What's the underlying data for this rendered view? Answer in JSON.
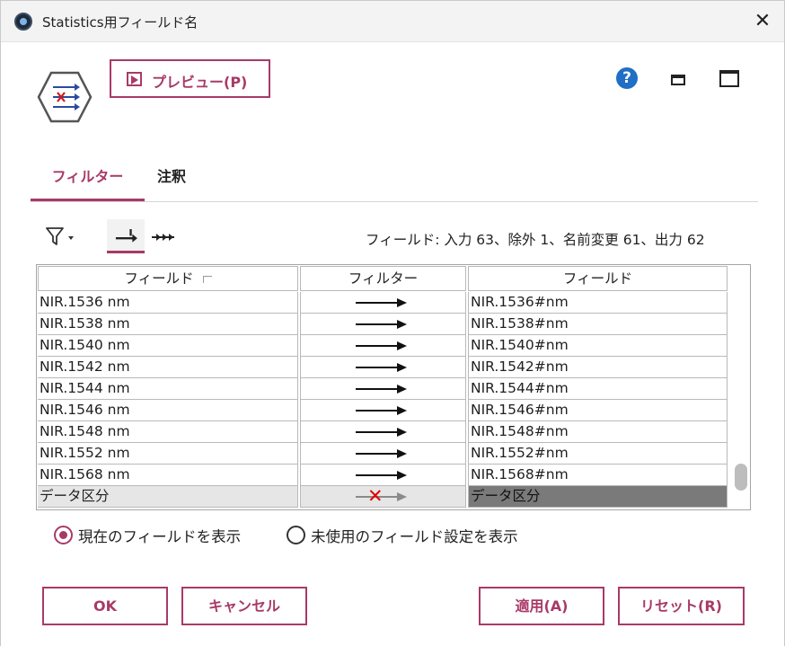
{
  "window": {
    "title": "Statistics用フィールド名",
    "close_glyph": "✕"
  },
  "toolbar": {
    "preview_label": "プレビュー(P)",
    "help_glyph": "?"
  },
  "tabs": [
    {
      "label": "フィルター",
      "active": true
    },
    {
      "label": "注釈",
      "active": false
    }
  ],
  "summary": "フィールド: 入力 63、除外 1、名前変更 61、出力 62",
  "table": {
    "headers": [
      "フィールド",
      "フィルター",
      "フィールド"
    ],
    "rows": [
      {
        "input": "NIR.1536 nm",
        "output": "NIR.1536#nm",
        "excluded": false
      },
      {
        "input": "NIR.1538 nm",
        "output": "NIR.1538#nm",
        "excluded": false
      },
      {
        "input": "NIR.1540 nm",
        "output": "NIR.1540#nm",
        "excluded": false
      },
      {
        "input": "NIR.1542 nm",
        "output": "NIR.1542#nm",
        "excluded": false
      },
      {
        "input": "NIR.1544 nm",
        "output": "NIR.1544#nm",
        "excluded": false
      },
      {
        "input": "NIR.1546 nm",
        "output": "NIR.1546#nm",
        "excluded": false
      },
      {
        "input": "NIR.1548 nm",
        "output": "NIR.1548#nm",
        "excluded": false
      },
      {
        "input": "NIR.1552 nm",
        "output": "NIR.1552#nm",
        "excluded": false
      },
      {
        "input": "NIR.1568 nm",
        "output": "NIR.1568#nm",
        "excluded": false
      },
      {
        "input": "データ区分",
        "output": "データ区分",
        "excluded": true
      }
    ]
  },
  "options": [
    {
      "label": "現在のフィールドを表示",
      "selected": true
    },
    {
      "label": "未使用のフィールド設定を表示",
      "selected": false
    }
  ],
  "buttons": {
    "ok": "OK",
    "cancel": "キャンセル",
    "apply": "適用(A)",
    "reset": "リセット(R)"
  },
  "icons": {
    "app": "spss-modeler-icon",
    "node": "filter-node-icon",
    "funnel": "funnel-dropdown-icon",
    "map_toggle": "toggle-mapping-icon",
    "all_toggle": "toggle-all-fields-icon",
    "help": "help-icon",
    "minimize": "minimize-icon",
    "maximize": "maximize-icon"
  },
  "colors": {
    "accent": "#a83a67",
    "help_blue": "#1f6fc5",
    "exclude_red": "#e00000"
  }
}
